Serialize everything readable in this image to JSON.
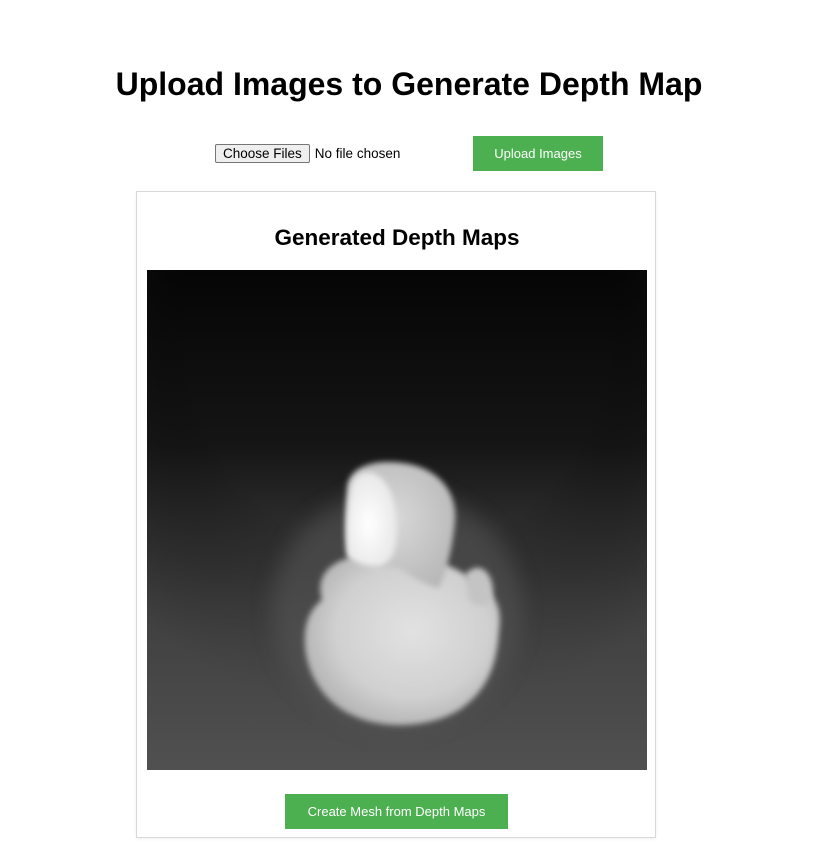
{
  "header": {
    "title": "Upload Images to Generate Depth Map"
  },
  "upload_form": {
    "choose_files_label": "Choose Files",
    "file_status": "No file chosen",
    "upload_button_label": "Upload Images"
  },
  "results": {
    "title": "Generated Depth Maps",
    "image_alt": "Generated depth map",
    "create_mesh_label": "Create Mesh from Depth Maps"
  },
  "colors": {
    "button_green": "#4caf50",
    "button_text": "#ffffff",
    "card_border": "#d8d8d8"
  }
}
